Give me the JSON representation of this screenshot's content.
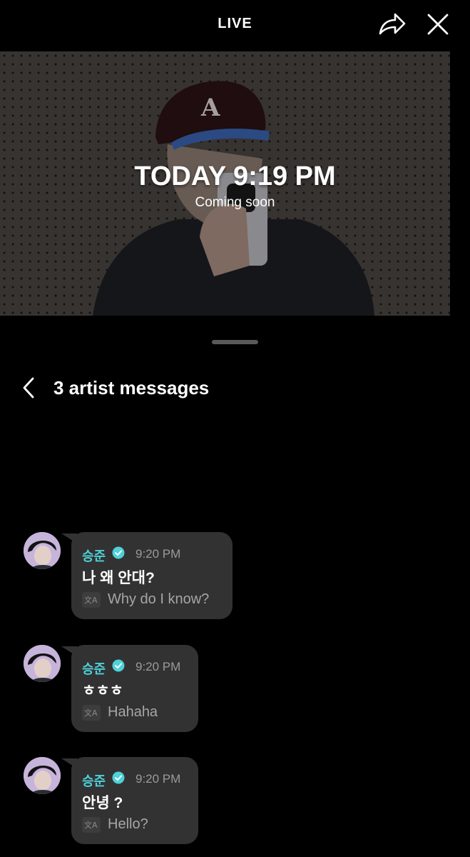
{
  "header": {
    "title": "LIVE",
    "share_icon": "share-icon",
    "close_icon": "close-icon"
  },
  "video": {
    "time": "TODAY 9:19 PM",
    "status": "Coming soon"
  },
  "panel": {
    "back_icon": "chevron-left-icon",
    "title": "3 artist messages"
  },
  "messages": [
    {
      "author": "승준",
      "time": "9:20 PM",
      "text": "나 왜 안대?",
      "translation": "Why do I know?"
    },
    {
      "author": "승준",
      "time": "9:20 PM",
      "text": "ㅎㅎㅎ",
      "translation": "Hahaha"
    },
    {
      "author": "승준",
      "time": "9:20 PM",
      "text": "안녕 ?",
      "translation": "Hello?"
    }
  ],
  "colors": {
    "background": "#000000",
    "accent": "#4fd1d9",
    "bubble": "#323232",
    "muted_text": "#a6a6a6"
  }
}
